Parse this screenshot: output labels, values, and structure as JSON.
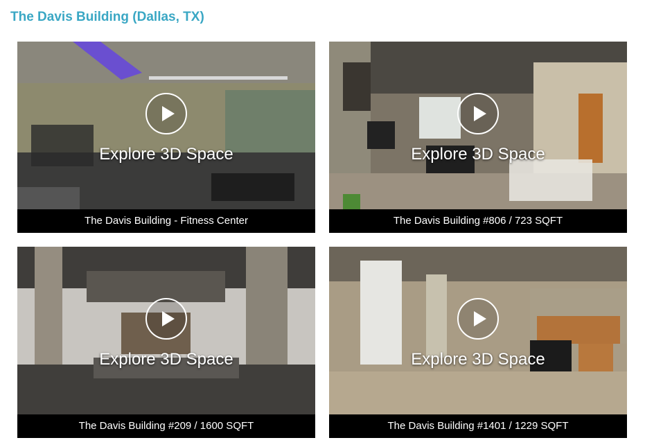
{
  "page": {
    "title": "The Davis Building (Dallas, TX)",
    "accent_color": "#3aa7c4"
  },
  "tours": [
    {
      "caption": "The Davis Building - Fitness Center",
      "overlay_label": "Explore 3D Space",
      "icon": "play-icon"
    },
    {
      "caption": "The Davis Building #806 / 723 SQFT",
      "overlay_label": "Explore 3D Space",
      "icon": "play-icon"
    },
    {
      "caption": "The Davis Building #209 / 1600 SQFT",
      "overlay_label": "Explore 3D Space",
      "icon": "play-icon"
    },
    {
      "caption": "The Davis Building #1401 / 1229 SQFT",
      "overlay_label": "Explore 3D Space",
      "icon": "play-icon"
    }
  ]
}
